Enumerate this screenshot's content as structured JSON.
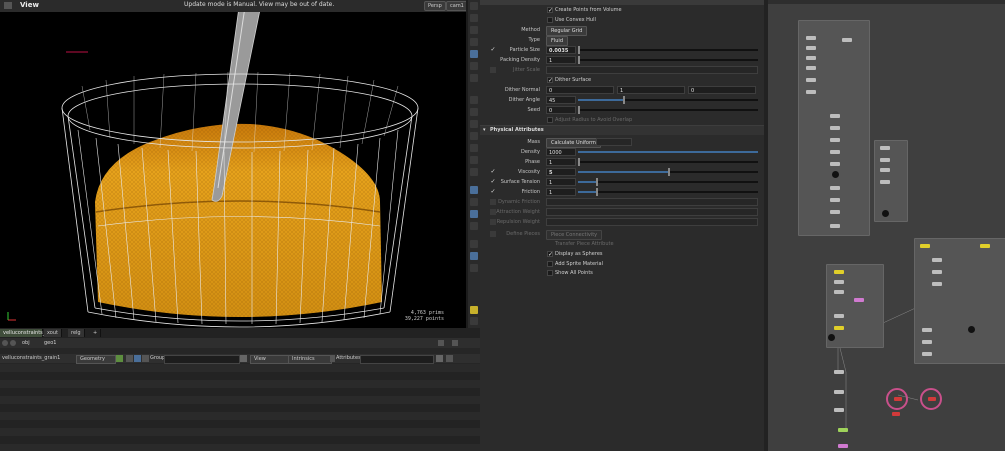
{
  "viewport": {
    "title": "View",
    "status": "Update mode is Manual. View may be out of date.",
    "persp": "Persp",
    "cam": "cam1",
    "stats": [
      "4,763  prims",
      "39,227  points"
    ]
  },
  "bottom_tabs": [
    "velluconstraints_...",
    "xout",
    "relg"
  ],
  "bottom_add": "+",
  "path": {
    "obj": "obj",
    "geo": "geo1"
  },
  "spreadsheet": {
    "node": "velluconstraints_grain1",
    "geometry": "Geometry",
    "group_label": "Group",
    "view": "View",
    "intrinsics": "Intrinsics",
    "attributes_label": "Attributes"
  },
  "params": {
    "create_points": {
      "label": "Create Points from Volume",
      "checked": true
    },
    "use_convex_hull": {
      "label": "Use Convex Hull",
      "checked": false
    },
    "method": {
      "label": "Method",
      "value": "Regular Grid"
    },
    "type": {
      "label": "Type",
      "value": "Fluid"
    },
    "particle_size": {
      "label": "Particle Size",
      "value": "0.0035"
    },
    "packing_density": {
      "label": "Packing Density",
      "value": "1"
    },
    "jitter_scale": {
      "label": "Jitter Scale"
    },
    "dither_surface": {
      "label": "Dither Surface",
      "checked": true
    },
    "dither_normal": {
      "label": "Dither Normal",
      "values": [
        "0",
        "1",
        "0"
      ]
    },
    "dither_angle": {
      "label": "Dither Angle",
      "value": "45"
    },
    "seed": {
      "label": "Seed",
      "value": "0"
    },
    "adjust_radius": {
      "label": "Adjust Radius to Avoid Overlap"
    },
    "physical_section": "Physical Attributes",
    "mass": {
      "label": "Mass",
      "value": "Calculate Uniform"
    },
    "density": {
      "label": "Density",
      "value": "1000"
    },
    "phase": {
      "label": "Phase",
      "value": "1"
    },
    "viscosity": {
      "label": "Viscosity",
      "value": "5"
    },
    "surface_tension": {
      "label": "Surface Tension",
      "value": "1"
    },
    "friction": {
      "label": "Friction",
      "value": "1"
    },
    "dynamic_friction": {
      "label": "Dynamic Friction"
    },
    "attraction_weight": {
      "label": "Attraction Weight"
    },
    "repulsion_weight": {
      "label": "Repulsion Weight"
    },
    "define_pieces": {
      "label": "Define Pieces",
      "value": "Piece Connectivity"
    },
    "transfer_piece": {
      "label": "Transfer Piece Attribute"
    },
    "display_spheres": {
      "label": "Display as Spheres",
      "checked": true
    },
    "add_sprite": {
      "label": "Add Sprite Material",
      "checked": false
    },
    "show_all_points": {
      "label": "Show All Points",
      "checked": false
    }
  },
  "colors": {
    "liquid": "#e6a21c",
    "liquid_dark": "#b36f08",
    "cup_lines": "#e8e8e8",
    "tab_active": "#3f4d3a",
    "slider_fill": "#3d6a9a",
    "node_yellow": "#e0cf2a",
    "node_green": "#9fd35b",
    "node_pink": "#d07ad0",
    "node_red": "#d23a3a"
  }
}
